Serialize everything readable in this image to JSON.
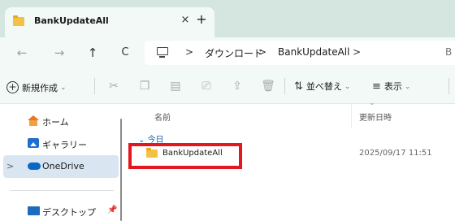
{
  "tab": {
    "title": "BankUpdateAll",
    "close_glyph": "×",
    "new_tab_glyph": "+"
  },
  "nav": {
    "back_glyph": "←",
    "forward_glyph": "→",
    "up_glyph": "↑",
    "refresh_glyph": "C"
  },
  "breadcrumb": {
    "separator": ">",
    "items": [
      "ダウンロード",
      "BankUpdateAll"
    ],
    "search_peek": "B"
  },
  "toolbar": {
    "new_label": "新規作成",
    "sort_label": "並べ替え",
    "view_label": "表示",
    "caret": "⌄"
  },
  "sidebar": {
    "items": [
      {
        "label": "ホーム",
        "icon": "home-icon"
      },
      {
        "label": "ギャラリー",
        "icon": "gallery-icon"
      },
      {
        "label": "OneDrive",
        "icon": "onedrive-icon",
        "selected": true
      },
      {
        "label": "デスクトップ",
        "icon": "desktop-icon",
        "pinned": true
      }
    ]
  },
  "filelist": {
    "columns": {
      "name": "名前",
      "modified": "更新日時"
    },
    "group": "今日",
    "rows": [
      {
        "name": "BankUpdateAll",
        "modified": "2025/09/17 11:51",
        "icon": "folder-icon"
      }
    ]
  },
  "colors": {
    "accent": "#1a5fb4",
    "highlight_box": "#e4161f",
    "folder": "#f4c144",
    "tabstrip": "#d4e6df"
  }
}
